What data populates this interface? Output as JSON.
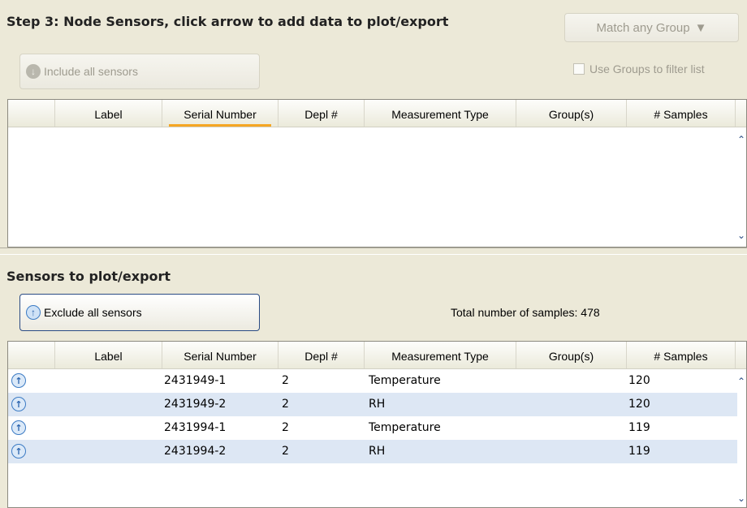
{
  "top_panel": {
    "title": "Step 3: Node Sensors, click arrow to add data to plot/export",
    "match_dropdown": {
      "label": "Match any Group",
      "arrow": "▼"
    },
    "include_button": {
      "label": "Include all sensors",
      "icon": "down-arrow-circle-icon"
    },
    "filter_checkbox": {
      "label": "Use Groups to filter list",
      "checked": false
    },
    "columns": [
      "Label",
      "Serial Number",
      "Depl #",
      "Measurement Type",
      "Group(s)",
      "# Samples"
    ],
    "sorted_column": "Serial Number",
    "rows": []
  },
  "bottom_panel": {
    "title": "Sensors to plot/export",
    "exclude_button": {
      "label": "Exclude all sensors",
      "icon": "up-arrow-circle-icon"
    },
    "total_samples_label": "Total number of samples:",
    "total_samples_value": "478",
    "columns": [
      "Label",
      "Serial Number",
      "Depl #",
      "Measurement Type",
      "Group(s)",
      "# Samples"
    ],
    "rows": [
      {
        "label": "",
        "serial": "2431949-1",
        "depl": "2",
        "type": "Temperature",
        "groups": "",
        "samples": "120"
      },
      {
        "label": "",
        "serial": "2431949-2",
        "depl": "2",
        "type": "RH",
        "groups": "",
        "samples": "120"
      },
      {
        "label": "",
        "serial": "2431994-1",
        "depl": "2",
        "type": "Temperature",
        "groups": "",
        "samples": "119"
      },
      {
        "label": "",
        "serial": "2431994-2",
        "depl": "2",
        "type": "RH",
        "groups": "",
        "samples": "119"
      }
    ]
  },
  "colors": {
    "background": "#ece9d8",
    "row_alt": "#dde7f4",
    "sort_indicator": "#f5a623",
    "button_border": "#2a4b84"
  }
}
